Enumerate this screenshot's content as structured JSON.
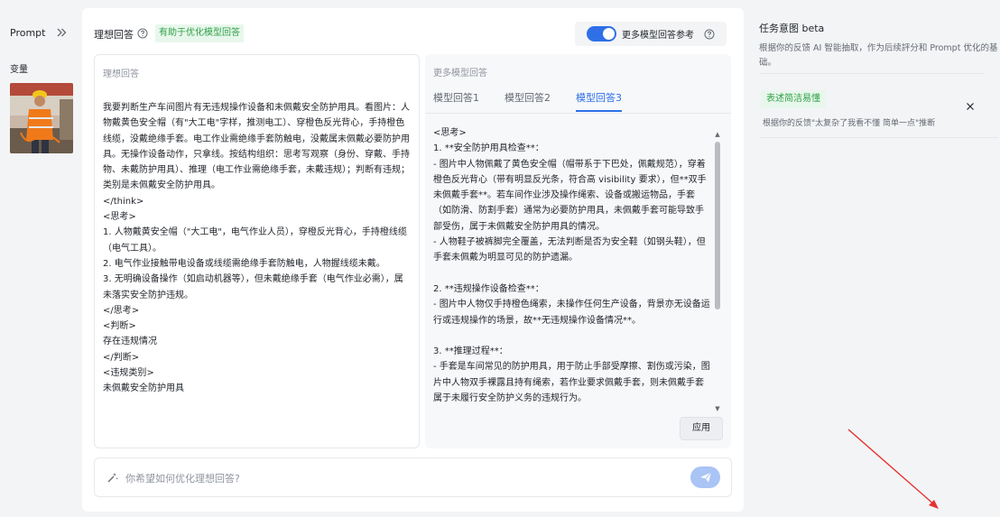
{
  "sidebar": {
    "prompt_label": "Prompt",
    "variable_label": "变量"
  },
  "header": {
    "title": "理想回答",
    "badge": "有助于优化模型回答",
    "toggle_label": "更多模型回答参考"
  },
  "ideal": {
    "label": "理想回答",
    "lines": [
      "我要判断生产车间图片有无违规操作设备和未佩戴安全防护用具。看图片：人物戴黄色安全帽（有\"大工电\"字样，推测电工）、穿橙色反光背心，手持橙色线缆，没戴绝缘手套。电工作业需绝缘手套防触电，没戴属未佩戴必要防护用具。无操作设备动作，只拿线。按结构组织：思考写观察（身份、穿戴、手持物、未戴防护用具）、推理（电工作业需绝缘手套，未戴违规）；判断有违规；类别是未佩戴安全防护用具。",
      "</think>",
      "<思考>",
      "1. 人物戴黄安全帽（\"大工电\"，电气作业人员），穿橙反光背心，手持橙线缆（电气工具）。",
      "2. 电气作业接触带电设备或线缆需绝缘手套防触电，人物握线缆未戴。",
      "3. 无明确设备操作（如启动机器等），但未戴绝缘手套（电气作业必需），属未落实安全防护违规。",
      "</思考>",
      "<判断>",
      "存在违规情况",
      "</判断>",
      "<违规类别>",
      "未佩戴安全防护用具"
    ]
  },
  "more": {
    "label": "更多模型回答",
    "tabs": [
      "模型回答1",
      "模型回答2",
      "模型回答3"
    ],
    "active_tab": 2,
    "lines": [
      "<思考>",
      "1. **安全防护用具检查**：",
      "   - 图片中人物佩戴了黄色安全帽（帽带系于下巴处，佩戴规范），穿着橙色反光背心（带有明显反光条，符合高 visibility 要求），但**双手未佩戴手套**。若车间作业涉及操作绳索、设备或搬运物品，手套（如防滑、防割手套）通常为必要防护用具，未佩戴手套可能导致手部受伤，属于未佩戴安全防护用具的情况。",
      "   - 人物鞋子被裤脚完全覆盖，无法判断是否为安全鞋（如钢头鞋），但手套未佩戴为明显可见的防护遗漏。",
      "",
      "2. **违规操作设备检查**：",
      "   - 图片中人物仅手持橙色绳索，未操作任何生产设备，背景亦无设备运行或违规操作的场景，故**无违规操作设备情况**。",
      "",
      "3. **推理过程**：",
      "   - 手套是车间常见的防护用具，用于防止手部受摩擦、割伤或污染，图片中人物双手裸露且持有绳索，若作业要求佩戴手套，则未佩戴手套属于未履行安全防护义务的违规行为。"
    ],
    "apply_label": "应用"
  },
  "input": {
    "placeholder": "你希望如何优化理想回答?"
  },
  "intent": {
    "title": "任务意图 beta",
    "description": "根据你的反馈 AI 智能抽取，作为后续評分和 Prompt 优化的基础。",
    "tag": "表述简洁易懂",
    "note": "根据你的反馈\"太复杂了我看不懂 简单一点\"推断"
  },
  "colors": {
    "accent": "#2f6fe8",
    "badge_green_text": "#2fa146",
    "badge_green_bg": "#e8f7ec",
    "annotation_arrow": "#e5322d"
  }
}
